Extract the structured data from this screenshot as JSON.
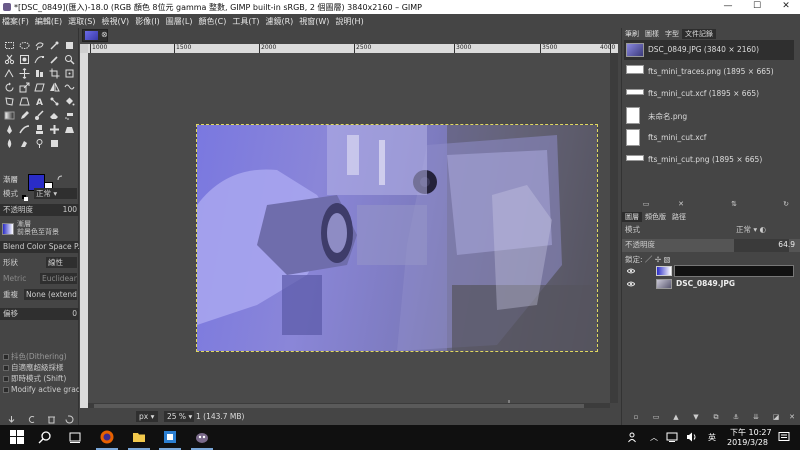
{
  "window": {
    "title": "*[DSC_0849](匯入)-18.0 (RGB 顏色 8位元 gamma 整數, GIMP built-in sRGB, 2 個圖層) 3840x2160 – GIMP",
    "controls": [
      "—",
      "☐",
      "✕"
    ]
  },
  "menu": [
    "檔案(F)",
    "編輯(E)",
    "選取(S)",
    "檢視(V)",
    "影像(I)",
    "圖層(L)",
    "顏色(C)",
    "工具(T)",
    "濾鏡(R)",
    "視窗(W)",
    "說明(H)"
  ],
  "tool_options": {
    "header": "漸層",
    "mode_label": "模式",
    "mode_value": "正常",
    "opacity_label": "不透明度",
    "opacity_value": "100",
    "gradient_label": "漸層",
    "gradient_name": "前景色至背景",
    "blend_space": "Blend Color Space P...",
    "shape_label": "形狀",
    "shape_value": "線性",
    "metric_label": "Metric",
    "metric_value": "Euclidean",
    "repeat_label": "重複",
    "repeat_value": "None (extend)",
    "offset_label": "偏移",
    "offset_value": "0",
    "dithering": "抖色(Dithering)",
    "adaptive": "自適應超級採樣",
    "instant": "即時模式 (Shift)",
    "modify_active": "Modify active gradie"
  },
  "canvas": {
    "ruler_ticks": [
      "1000",
      "1500",
      "2000",
      "2500",
      "3000",
      "3500",
      "4000"
    ]
  },
  "statusbar": {
    "unit": "px",
    "zoom": "25 %",
    "info": "1 (143.7 MB)"
  },
  "images_panel": {
    "tabs": [
      "筆刷",
      "圖樣",
      "字型",
      "文件記錄"
    ],
    "items": [
      {
        "label": "DSC_0849.JPG (3840 × 2160)"
      },
      {
        "label": "fts_mini_traces.png (1895 × 665)"
      },
      {
        "label": "fts_mini_cut.xcf (1895 × 665)"
      },
      {
        "label": "未命名.png"
      },
      {
        "label": "fts_mini_cut.xcf"
      },
      {
        "label": "fts_mini_cut.png (1895 × 665)"
      }
    ]
  },
  "layers_panel": {
    "tabs": [
      "圖層",
      "頻色版",
      "路徑"
    ],
    "mode_label": "模式",
    "mode_value": "正常",
    "opacity_label": "不透明度",
    "opacity_value": "64.9",
    "lock_label": "鎖定:",
    "layers": [
      {
        "name": ""
      },
      {
        "name": "DSC_0849.JPG"
      }
    ]
  },
  "taskbar": {
    "lang": "英",
    "time": "下午 10:27",
    "date": "2019/3/28"
  },
  "colors": {
    "foreground": "#2a2cc7",
    "background": "#ffffff",
    "selection_marquee": "#e0d860"
  }
}
